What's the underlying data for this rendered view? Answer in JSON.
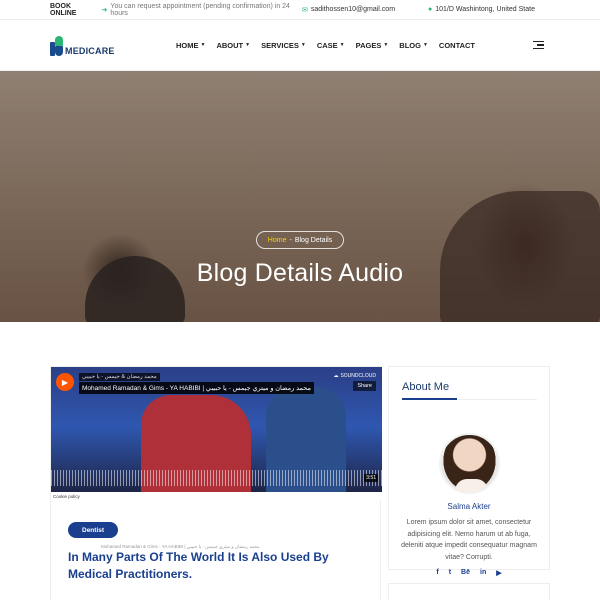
{
  "topbar": {
    "book_label": "BOOK ONLINE",
    "book_text": "You can request appointment (pending confirmation) in 24 hours",
    "email": "sadithossen10@gmail.com",
    "address": "101/D Washintong, United State"
  },
  "header": {
    "logo_text": "MEDICARE",
    "nav": [
      {
        "label": "HOME",
        "has_dropdown": true
      },
      {
        "label": "ABOUT",
        "has_dropdown": true
      },
      {
        "label": "SERVICES",
        "has_dropdown": true
      },
      {
        "label": "CASE",
        "has_dropdown": true
      },
      {
        "label": "PAGES",
        "has_dropdown": true
      },
      {
        "label": "BLOG",
        "has_dropdown": true
      },
      {
        "label": "CONTACT",
        "has_dropdown": false
      }
    ]
  },
  "hero": {
    "breadcrumb_home": "Home",
    "breadcrumb_sep": "-",
    "breadcrumb_current": "Blog Details",
    "title": "Blog Details Audio"
  },
  "post": {
    "player": {
      "artist": "محمد رمضان & جيمس - يا حبيبي",
      "title": "Mohamed Ramadan & Gims - YA HABIBI | محمد رمضان و ميتري جيمس - يا حبيبي",
      "brand": "SOUNDCLOUD",
      "share": "Share",
      "time": "3:51",
      "cookie": "Cookie policy"
    },
    "category": "Dentist",
    "title": "In Many Parts Of The World It Is Also Used By Medical Practitioners."
  },
  "sidebar": {
    "about_heading": "About Me",
    "author_name": "Salma Akter",
    "bio": "Lorem ipsum dolor sit amet, consectetur adipisicing elit. Nemo harum ut ab fuga, deleniti atque impedit consequatur magnam vitae? Corrupti.",
    "social": [
      {
        "icon": "facebook-icon",
        "glyph": "f"
      },
      {
        "icon": "twitter-icon",
        "glyph": "t"
      },
      {
        "icon": "behance-icon",
        "glyph": "Bē"
      },
      {
        "icon": "linkedin-icon",
        "glyph": "in"
      },
      {
        "icon": "youtube-icon",
        "glyph": "▶"
      }
    ]
  },
  "colors": {
    "brand_blue": "#1a3f8f",
    "accent_green": "#2bb673",
    "breadcrumb_home": "#f5d300",
    "soundcloud": "#ff5500"
  }
}
